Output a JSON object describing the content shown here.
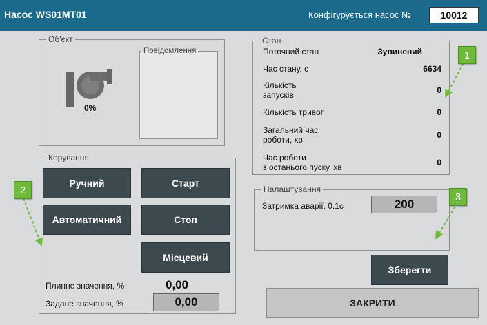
{
  "header": {
    "title": "Насос WS01MT01",
    "config_label": "Конфігурується насос №",
    "config_value": "10012"
  },
  "object": {
    "legend": "Об'єкт",
    "pump_percent": "0%",
    "messages_legend": "Повідомлення"
  },
  "state": {
    "legend": "Стан",
    "current_state_label": "Поточний стан",
    "current_state_value": "Зупинений",
    "state_time_label": "Час стану, с",
    "state_time_value": "6634",
    "starts_label_l1": "Кількість",
    "starts_label_l2": "запусків",
    "starts_value": "0",
    "alarms_label": "Кількість тривог",
    "alarms_value": "0",
    "total_time_l1": "Загальний час",
    "total_time_l2": "роботи, хв",
    "total_time_value": "0",
    "last_run_l1": "Час роботи",
    "last_run_l2": "з останього пуску, хв",
    "last_run_value": "0"
  },
  "control": {
    "legend": "Керування",
    "manual": "Ручний",
    "start": "Старт",
    "auto": "Автоматичний",
    "stop": "Стоп",
    "local": "Місцевий",
    "current_label": "Плинне значення, %",
    "current_value": "0,00",
    "setpoint_label": "Задане значення, %",
    "setpoint_value": "0,00"
  },
  "settings": {
    "legend": "Налаштування",
    "delay_label": "Затримка аварії, 0.1с",
    "delay_value": "200"
  },
  "actions": {
    "save": "Зберегти",
    "close": "ЗАКРИТИ"
  },
  "markers": [
    "1",
    "2",
    "3"
  ],
  "colors": {
    "titlebar": "#1b6a8c",
    "button": "#3c494f",
    "marker": "#6fba3d",
    "background": "#d9dbdc"
  }
}
